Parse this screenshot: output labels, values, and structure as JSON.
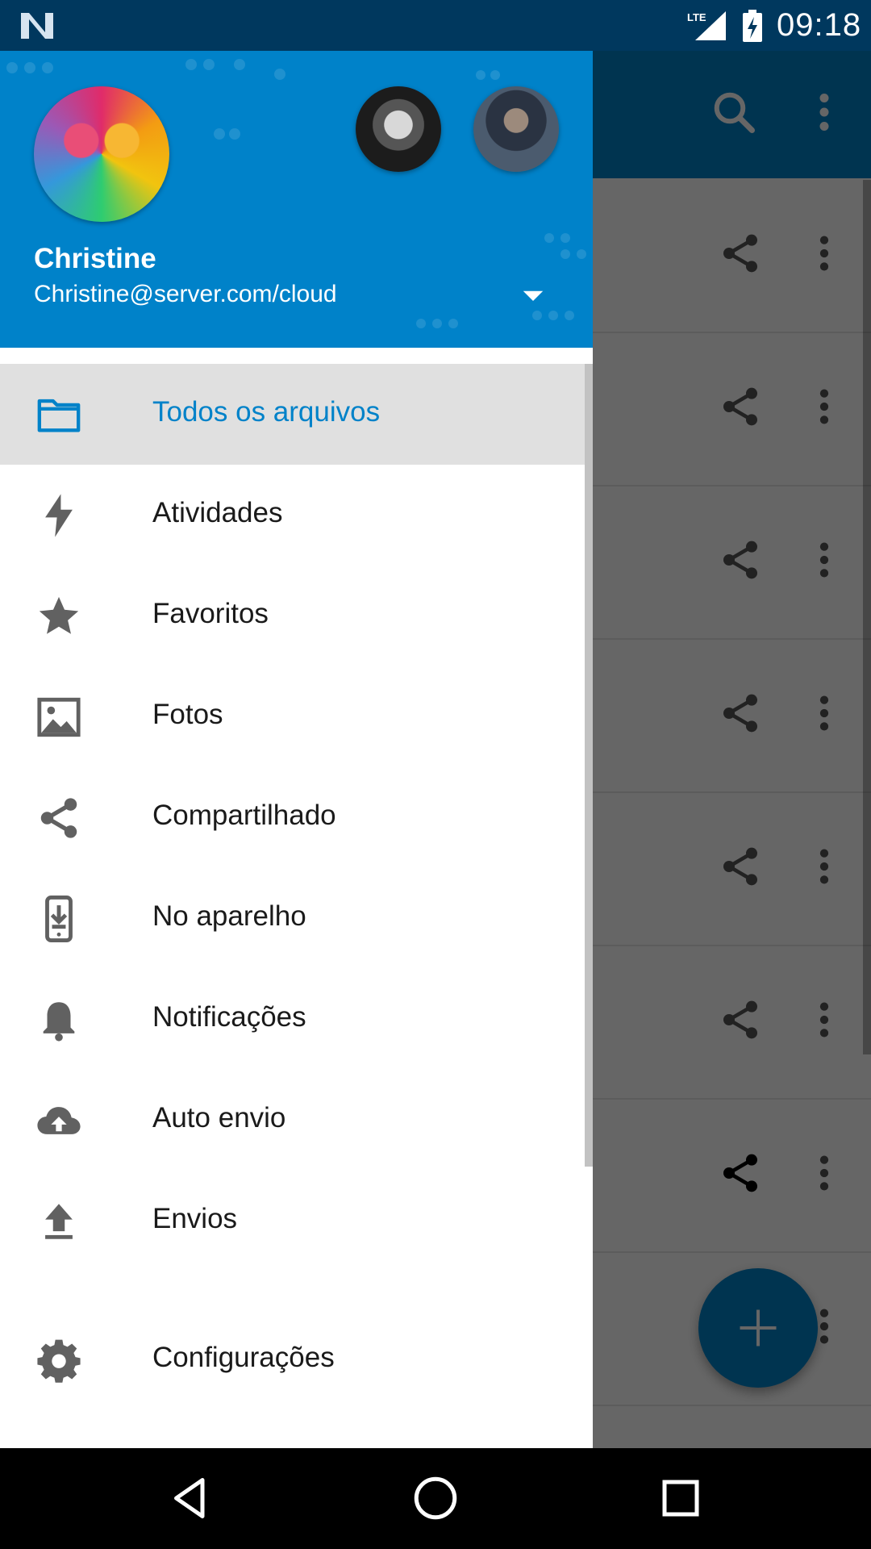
{
  "status_bar": {
    "time": "09:18",
    "network": "LTE",
    "icons": [
      "nougat-logo-icon",
      "lte-signal-icon",
      "battery-charging-icon"
    ]
  },
  "app": {
    "toolbar": {
      "icons": [
        "search-icon",
        "more-vert-icon"
      ]
    },
    "row_actions": [
      "share-icon",
      "more-vert-icon"
    ],
    "row_count": 8,
    "fab_icon": "plus-icon",
    "colors": {
      "primary": "#0082c9"
    }
  },
  "drawer": {
    "header": {
      "user_name": "Christine",
      "user_email": "Christine@server.com/cloud",
      "toggle_icon": "arrow-drop-down-icon"
    },
    "items": [
      {
        "label": "Todos os arquivos",
        "icon": "folder-icon",
        "active": true
      },
      {
        "label": "Atividades",
        "icon": "lightning-icon"
      },
      {
        "label": "Favoritos",
        "icon": "star-icon"
      },
      {
        "label": "Fotos",
        "icon": "image-icon"
      },
      {
        "label": "Compartilhado",
        "icon": "share-icon"
      },
      {
        "label": "No aparelho",
        "icon": "phone-download-icon"
      },
      {
        "label": "Notificações",
        "icon": "bell-icon"
      },
      {
        "label": "Auto envio",
        "icon": "cloud-upload-icon"
      },
      {
        "label": "Envios",
        "icon": "upload-icon"
      },
      {
        "label": "Configurações",
        "icon": "gear-icon"
      }
    ]
  },
  "nav_bar": {
    "icons": [
      "back-icon",
      "home-icon",
      "recents-icon"
    ]
  }
}
